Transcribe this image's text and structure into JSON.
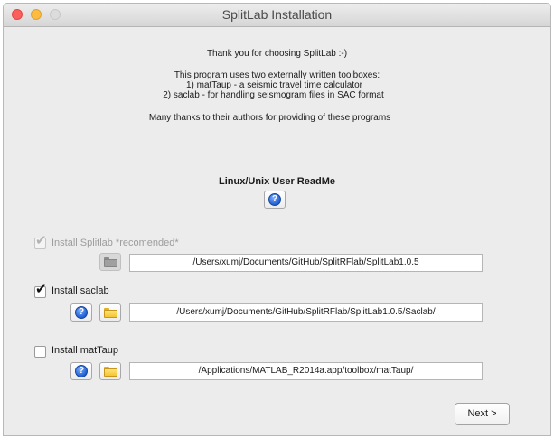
{
  "window": {
    "title": "SplitLab Installation"
  },
  "intro": {
    "line1": "Thank you for choosing SplitLab :-)",
    "line2": "This program uses two externally written toolboxes:",
    "line3": "1) matTaup  - a seismic travel time calculator",
    "line4": "2) saclab   - for handling seismogram files in SAC format",
    "line5": "Many thanks to their authors for providing of these programs"
  },
  "readme": {
    "label": "Linux/Unix User ReadMe",
    "help_icon": "help-icon"
  },
  "options": [
    {
      "label": "Install Splitlab *recomended*",
      "checked": true,
      "disabled": true,
      "path": "/Users/xumj/Documents/GitHub/SplitRFlab/SplitLab1.0.5"
    },
    {
      "label": "Install saclab",
      "checked": true,
      "disabled": false,
      "path": "/Users/xumj/Documents/GitHub/SplitRFlab/SplitLab1.0.5/Saclab/"
    },
    {
      "label": "Install matTaup",
      "checked": false,
      "disabled": false,
      "path": "/Applications/MATLAB_R2014a.app/toolbox/matTaup/"
    }
  ],
  "buttons": {
    "next": "Next >"
  },
  "icons": {
    "help": "?",
    "check": "✔"
  },
  "colors": {
    "close": "#fc605c",
    "minimize": "#fdbc40",
    "help_blue": "#1f5fd1",
    "folder_yellow": "#f5c531"
  }
}
